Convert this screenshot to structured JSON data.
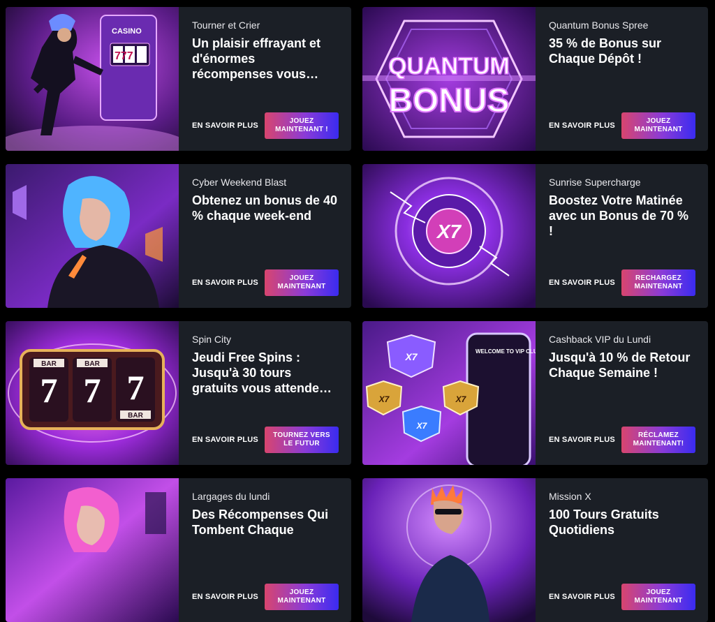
{
  "colors": {
    "background": "#000000",
    "card": "#1b1f26",
    "cta_start": "#d8456e",
    "cta_end": "#3a2bf0"
  },
  "promotions": [
    {
      "kicker": "Tourner et Crier",
      "headline": "Un plaisir effrayant et d'énormes récompenses vous…",
      "learn": "EN SAVOIR PLUS",
      "cta": "JOUEZ MAINTENANT !",
      "image": "cyberpunk-man-slot-machine",
      "image_text": "CASINO"
    },
    {
      "kicker": "Quantum Bonus Spree",
      "headline": "35 % de Bonus sur Chaque Dépôt !",
      "learn": "EN SAVOIR PLUS",
      "cta": "JOUEZ MAINTENANT",
      "image": "quantum-bonus-logo",
      "image_text": "QUANTUM BONUS"
    },
    {
      "kicker": "Cyber Weekend Blast",
      "headline": "Obtenez un bonus de 40 % chaque week-end",
      "learn": "EN SAVOIR PLUS",
      "cta": "JOUEZ MAINTENANT",
      "image": "cyberpunk-woman",
      "image_text": ""
    },
    {
      "kicker": "Sunrise Supercharge",
      "headline": "Boostez Votre Matinée avec un Bonus de 70 % !",
      "learn": "EN SAVOIR PLUS",
      "cta": "RECHARGEZ MAINTENANT",
      "image": "x7-lightning-orb",
      "image_text": "X7"
    },
    {
      "kicker": "Spin City",
      "headline": "Jeudi Free Spins : Jusqu'à 30 tours gratuits vous attende…",
      "learn": "EN SAVOIR PLUS",
      "cta": "TOURNEZ VERS LE FUTUR",
      "image": "777-slot-reels",
      "image_text": "777"
    },
    {
      "kicker": "Cashback VIP du Lundi",
      "headline": "Jusqu'à 10 % de Retour Chaque Semaine !",
      "learn": "EN SAVOIR PLUS",
      "cta": "RÉCLAMEZ MAINTENANT!",
      "image": "vip-club-phone-badges",
      "image_text": "WELCOME TO VIP CLUB"
    },
    {
      "kicker": "Largages du lundi",
      "headline": "Des Récompenses Qui Tombent Chaque",
      "learn": "EN SAVOIR PLUS",
      "cta": "JOUEZ MAINTENANT",
      "image": "cyberpunk-woman-pink",
      "image_text": ""
    },
    {
      "kicker": "Mission X",
      "headline": "100 Tours Gratuits Quotidiens",
      "learn": "EN SAVOIR PLUS",
      "cta": "JOUEZ MAINTENANT",
      "image": "cyberpunk-punk-sunglasses",
      "image_text": ""
    }
  ]
}
